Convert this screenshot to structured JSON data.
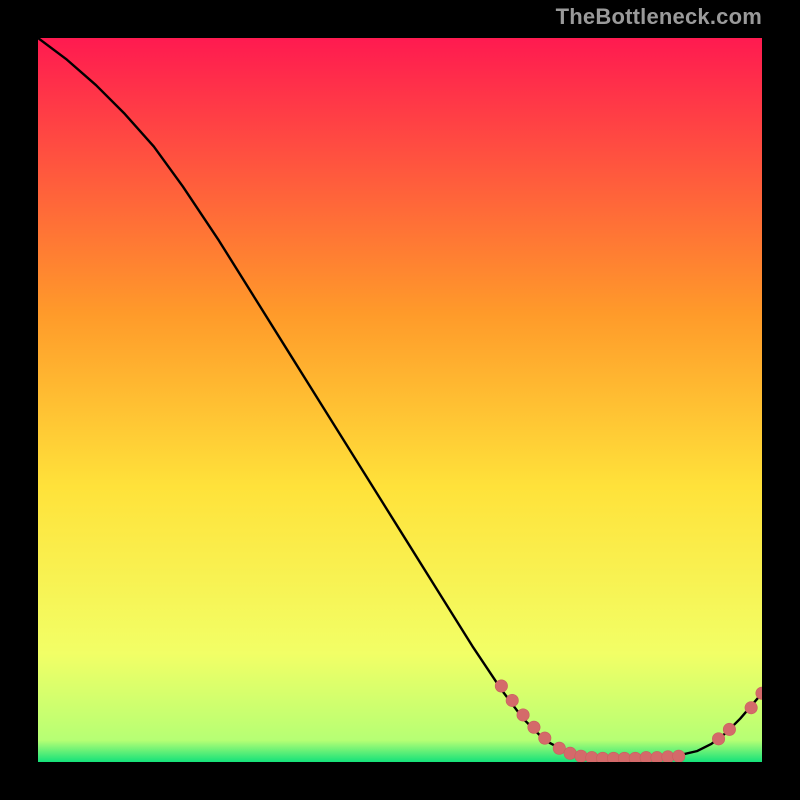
{
  "watermark": "TheBottleneck.com",
  "colors": {
    "background": "#000000",
    "gradient_top": "#ff1a50",
    "gradient_mid1": "#ff9a2a",
    "gradient_mid2": "#ffe23a",
    "gradient_band": "#f2ff66",
    "gradient_bottom": "#14e27a",
    "curve": "#000000",
    "marker_fill": "#d46a6a",
    "marker_stroke": "#c95f5f"
  },
  "chart_data": {
    "type": "line",
    "title": "",
    "xlabel": "",
    "ylabel": "",
    "xlim": [
      0,
      100
    ],
    "ylim": [
      0,
      100
    ],
    "grid": false,
    "legend": false,
    "curve": [
      {
        "x": 0,
        "y": 100
      },
      {
        "x": 4,
        "y": 97
      },
      {
        "x": 8,
        "y": 93.5
      },
      {
        "x": 12,
        "y": 89.5
      },
      {
        "x": 16,
        "y": 85
      },
      {
        "x": 20,
        "y": 79.5
      },
      {
        "x": 25,
        "y": 72
      },
      {
        "x": 30,
        "y": 64
      },
      {
        "x": 35,
        "y": 56
      },
      {
        "x": 40,
        "y": 48
      },
      {
        "x": 45,
        "y": 40
      },
      {
        "x": 50,
        "y": 32
      },
      {
        "x": 55,
        "y": 24
      },
      {
        "x": 60,
        "y": 16
      },
      {
        "x": 64,
        "y": 10
      },
      {
        "x": 67,
        "y": 6
      },
      {
        "x": 70,
        "y": 3
      },
      {
        "x": 73,
        "y": 1.4
      },
      {
        "x": 76,
        "y": 0.7
      },
      {
        "x": 79,
        "y": 0.5
      },
      {
        "x": 82,
        "y": 0.5
      },
      {
        "x": 85,
        "y": 0.6
      },
      {
        "x": 88,
        "y": 0.8
      },
      {
        "x": 91,
        "y": 1.5
      },
      {
        "x": 93,
        "y": 2.5
      },
      {
        "x": 95,
        "y": 4.0
      },
      {
        "x": 97,
        "y": 6.0
      },
      {
        "x": 100,
        "y": 9.5
      }
    ],
    "markers": [
      {
        "x": 64.0,
        "y": 10.5
      },
      {
        "x": 65.5,
        "y": 8.5
      },
      {
        "x": 67.0,
        "y": 6.5
      },
      {
        "x": 68.5,
        "y": 4.8
      },
      {
        "x": 70.0,
        "y": 3.3
      },
      {
        "x": 72.0,
        "y": 1.9
      },
      {
        "x": 73.5,
        "y": 1.2
      },
      {
        "x": 75.0,
        "y": 0.8
      },
      {
        "x": 76.5,
        "y": 0.6
      },
      {
        "x": 78.0,
        "y": 0.5
      },
      {
        "x": 79.5,
        "y": 0.5
      },
      {
        "x": 81.0,
        "y": 0.5
      },
      {
        "x": 82.5,
        "y": 0.5
      },
      {
        "x": 84.0,
        "y": 0.6
      },
      {
        "x": 85.5,
        "y": 0.6
      },
      {
        "x": 87.0,
        "y": 0.7
      },
      {
        "x": 88.5,
        "y": 0.8
      },
      {
        "x": 94.0,
        "y": 3.2
      },
      {
        "x": 95.5,
        "y": 4.5
      },
      {
        "x": 98.5,
        "y": 7.5
      },
      {
        "x": 100.0,
        "y": 9.5
      }
    ]
  }
}
